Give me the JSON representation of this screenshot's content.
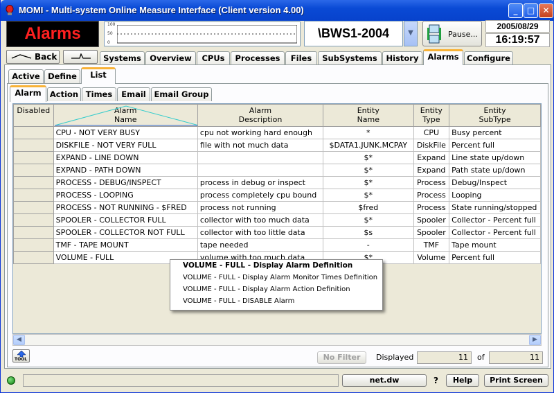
{
  "window": {
    "title": "MOMI - Multi-system Online Measure Interface (Client version 4.00)",
    "controls": {
      "minimize": "_",
      "maximize": "□",
      "close": "✕"
    }
  },
  "header": {
    "banner": "Alarms",
    "graph_labels": [
      "100",
      "50",
      "0",
      "100",
      "50",
      "0"
    ],
    "system": "\\BWS1-2004",
    "pause_label": "Pause...",
    "date": "2005/08/29",
    "time": "16:19:57"
  },
  "nav": {
    "back_label": "Back",
    "forward_label": "",
    "tabs": [
      "Systems",
      "Overview",
      "CPUs",
      "Processes",
      "Files",
      "SubSystems",
      "History",
      "Alarms",
      "Configure"
    ],
    "selected_tab": "Alarms"
  },
  "subtabs": {
    "items": [
      "Active",
      "Define",
      "List"
    ],
    "selected": "List"
  },
  "listtabs": {
    "items": [
      "Alarm",
      "Action",
      "Times",
      "Email",
      "Email Group"
    ],
    "selected": "Alarm"
  },
  "table": {
    "columns": [
      {
        "line1": "Disabled",
        "line2": ""
      },
      {
        "line1": "Alarm",
        "line2": "Name"
      },
      {
        "line1": "Alarm",
        "line2": "Description"
      },
      {
        "line1": "Entity",
        "line2": "Name"
      },
      {
        "line1": "Entity",
        "line2": "Type"
      },
      {
        "line1": "Entity",
        "line2": "SubType"
      }
    ],
    "rows": [
      {
        "disabled": "",
        "name": "CPU - NOT VERY BUSY",
        "description": "cpu not working hard enough",
        "entity_name": "*",
        "entity_type": "CPU",
        "entity_subtype": "Busy percent"
      },
      {
        "disabled": "",
        "name": "DISKFILE - NOT VERY FULL",
        "description": "file with not much data",
        "entity_name": "$DATA1.JUNK.MCPAY",
        "entity_type": "DiskFile",
        "entity_subtype": "Percent full"
      },
      {
        "disabled": "",
        "name": "EXPAND - LINE DOWN",
        "description": "",
        "entity_name": "$*",
        "entity_type": "Expand",
        "entity_subtype": "Line state up/down"
      },
      {
        "disabled": "",
        "name": "EXPAND - PATH DOWN",
        "description": "",
        "entity_name": "$*",
        "entity_type": "Expand",
        "entity_subtype": "Path state up/down"
      },
      {
        "disabled": "",
        "name": "PROCESS - DEBUG/INSPECT",
        "description": "process in debug or inspect",
        "entity_name": "$*",
        "entity_type": "Process",
        "entity_subtype": "Debug/Inspect"
      },
      {
        "disabled": "",
        "name": "PROCESS - LOOPING",
        "description": "process completely cpu bound",
        "entity_name": "$*",
        "entity_type": "Process",
        "entity_subtype": "Looping"
      },
      {
        "disabled": "",
        "name": "PROCESS - NOT RUNNING - $FRED",
        "description": "process not running",
        "entity_name": "$fred",
        "entity_type": "Process",
        "entity_subtype": "State running/stopped"
      },
      {
        "disabled": "",
        "name": "SPOOLER - COLLECTOR FULL",
        "description": "collector with too much data",
        "entity_name": "$*",
        "entity_type": "Spooler",
        "entity_subtype": "Collector - Percent full"
      },
      {
        "disabled": "",
        "name": "SPOOLER - COLLECTOR NOT FULL",
        "description": "collector with too little data",
        "entity_name": "$s",
        "entity_type": "Spooler",
        "entity_subtype": "Collector - Percent full"
      },
      {
        "disabled": "",
        "name": "TMF - TAPE MOUNT",
        "description": "tape needed",
        "entity_name": "-",
        "entity_type": "TMF",
        "entity_subtype": "Tape mount"
      },
      {
        "disabled": "",
        "name": "VOLUME - FULL",
        "description": "volume with too much data",
        "entity_name": "$*",
        "entity_type": "Volume",
        "entity_subtype": "Percent full"
      }
    ]
  },
  "context_menu": {
    "items": [
      "VOLUME - FULL - Display Alarm Definition",
      "VOLUME - FULL - Display Alarm Monitor Times Definition",
      "VOLUME - FULL - Display Alarm Action Definition",
      "VOLUME - FULL - DISABLE Alarm"
    ]
  },
  "footer": {
    "tool_label": "TOOL",
    "no_filter_label": "No Filter",
    "displayed_label": "Displayed",
    "displayed_count": "11",
    "of_label": "of",
    "total_count": "11"
  },
  "statusbar": {
    "server": "net.dw",
    "question": "?",
    "help_label": "Help",
    "print_label": "Print Screen"
  },
  "colors": {
    "titlebar": "#0a4ad5",
    "banner_text": "#ff2020",
    "active_tab_accent": "#f8b237"
  }
}
